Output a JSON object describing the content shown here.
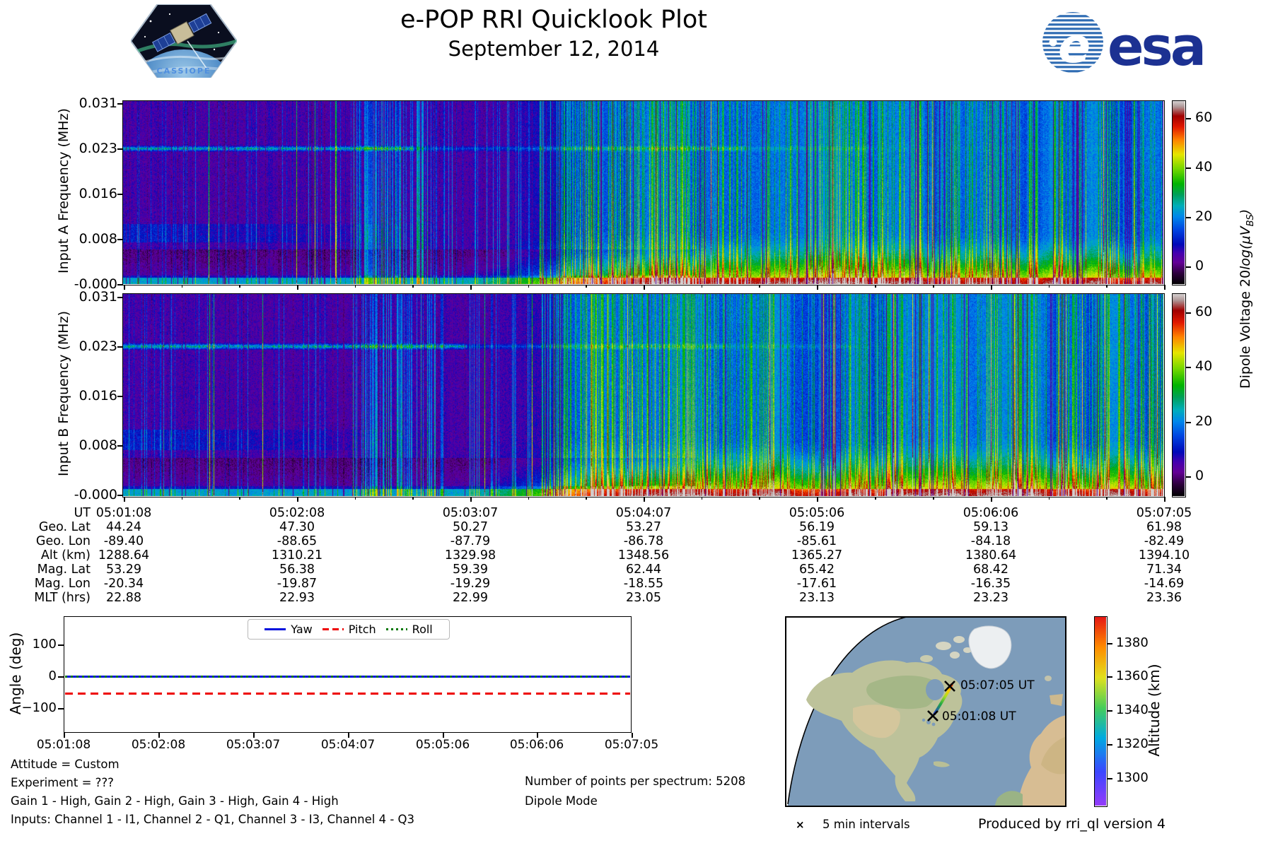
{
  "header": {
    "title": "e-POP RRI Quicklook Plot",
    "date": "September 12, 2014"
  },
  "logos": {
    "cassiope": "CASSIOPE",
    "esa": "esa",
    "esa_e": "e"
  },
  "colorbar": {
    "label_prefix": "Dipole Voltage 20",
    "label_log": "log(μV",
    "label_sub": "BS",
    "label_close": ")",
    "ticks": [
      "60",
      "40",
      "20",
      "0"
    ]
  },
  "footer": {
    "attitude": "Attitude = Custom",
    "experiment": "Experiment = ???",
    "gains": "Gain 1 - High, Gain 2 - High, Gain 3 - High, Gain 4 - High",
    "inputs": "Inputs: Channel 1 - I1, Channel 2 - Q1, Channel 3 - I3, Channel 4 - Q3",
    "points": "Number of points per spectrum: 5208",
    "mode": "Dipole Mode"
  },
  "map": {
    "start_label": "05:01:08 UT",
    "end_label": "05:07:05 UT",
    "legend_marker": "×",
    "legend_text": "5 min intervals",
    "produced_by": "Produced by rri_ql version 4",
    "colorbar_label": "Altitude (km)",
    "colorbar_ticks": [
      "1380",
      "1360",
      "1340",
      "1320",
      "1300"
    ]
  },
  "chart_data": [
    {
      "type": "heatmap",
      "id": "spectrogram_input_a",
      "ylabel": "Input A Frequency (MHz)",
      "yticks": [
        "0.031",
        "0.023",
        "0.016",
        "0.008",
        "-0.000"
      ],
      "y_range_mhz": [
        0.0,
        0.031
      ],
      "xticks_ut": [
        "05:01:08",
        "05:02:08",
        "05:03:07",
        "05:04:07",
        "05:05:06",
        "05:06:06",
        "05:07:05"
      ],
      "value_label": "Dipole Voltage 20log(μV_BS)",
      "value_ticks": [
        0,
        20,
        40,
        60
      ],
      "value_range": [
        -7.5,
        66.5
      ],
      "colormap": "nipy_spectral",
      "features": [
        "persistent narrowband emission line at 0.023 MHz, fading after ~05:03",
        "faint band near 0.008-0.010 MHz before 05:03",
        "dense vertical interference streaks throughout",
        "background rises from near-black to blue after ~05:03:30",
        "bright green broadband enhancement at lowest frequencies on right half"
      ]
    },
    {
      "type": "heatmap",
      "id": "spectrogram_input_b",
      "ylabel": "Input B Frequency (MHz)",
      "yticks": [
        "0.031",
        "0.023",
        "0.016",
        "0.008",
        "-0.000"
      ],
      "y_range_mhz": [
        0.0,
        0.031
      ],
      "xticks_ut": [
        "05:01:08",
        "05:02:08",
        "05:03:07",
        "05:04:07",
        "05:05:06",
        "05:06:06",
        "05:07:05"
      ],
      "value_label": "Dipole Voltage 20log(μV_BS)",
      "value_ticks": [
        0,
        20,
        40,
        60
      ],
      "value_range": [
        -7.5,
        66.5
      ],
      "colormap": "nipy_spectral",
      "features": [
        "same morphology as Input A: 0.023 MHz line, interference streaks, low-frequency green band after ~05:03"
      ]
    },
    {
      "type": "table",
      "id": "ephemeris",
      "rows": [
        {
          "label": "UT",
          "values": [
            "05:01:08",
            "05:02:08",
            "05:03:07",
            "05:04:07",
            "05:05:06",
            "05:06:06",
            "05:07:05"
          ]
        },
        {
          "label": "Geo. Lat",
          "values": [
            "44.24",
            "47.30",
            "50.27",
            "53.27",
            "56.19",
            "59.13",
            "61.98"
          ]
        },
        {
          "label": "Geo. Lon",
          "values": [
            "-89.40",
            "-88.65",
            "-87.79",
            "-86.78",
            "-85.61",
            "-84.18",
            "-82.49"
          ]
        },
        {
          "label": "Alt (km)",
          "values": [
            "1288.64",
            "1310.21",
            "1329.98",
            "1348.56",
            "1365.27",
            "1380.64",
            "1394.10"
          ]
        },
        {
          "label": "Mag. Lat",
          "values": [
            "53.29",
            "56.38",
            "59.39",
            "62.44",
            "65.42",
            "68.42",
            "71.34"
          ]
        },
        {
          "label": "Mag. Lon",
          "values": [
            "-20.34",
            "-19.87",
            "-19.29",
            "-18.55",
            "-17.61",
            "-16.35",
            "-14.69"
          ]
        },
        {
          "label": "MLT (hrs)",
          "values": [
            "22.88",
            "22.93",
            "22.99",
            "23.05",
            "23.13",
            "23.23",
            "23.36"
          ]
        }
      ]
    },
    {
      "type": "line",
      "id": "attitude_angles",
      "ylabel": "Angle (deg)",
      "yticks": [
        "100",
        "0",
        "−100"
      ],
      "ylim": [
        -185,
        185
      ],
      "xticks": [
        "05:01:08",
        "05:02:08",
        "05:03:07",
        "05:04:07",
        "05:05:06",
        "05:06:06",
        "05:07:05"
      ],
      "legend_position": "upper center",
      "series": [
        {
          "name": "Yaw",
          "color": "#0011dd",
          "style": "solid",
          "values": [
            0,
            0,
            0,
            0,
            0,
            0,
            0
          ]
        },
        {
          "name": "Pitch",
          "color": "#ee0000",
          "style": "dashed",
          "values": [
            -55,
            -55,
            -55,
            -55,
            -55,
            -55,
            -55
          ]
        },
        {
          "name": "Roll",
          "color": "#007700",
          "style": "dotted",
          "values": [
            0,
            0,
            0,
            0,
            0,
            0,
            0
          ]
        }
      ]
    },
    {
      "type": "map-track",
      "id": "ground_track",
      "region": "North America / North Atlantic orthographic view",
      "track": {
        "start_ut": "05:01:08",
        "end_ut": "05:07:05",
        "start_geo_lat_lon": [
          44.24,
          -89.4
        ],
        "end_geo_lat_lon": [
          61.98,
          -82.49
        ],
        "altitude_km_range": [
          1288.64,
          1394.1
        ]
      },
      "colorbar": {
        "label": "Altitude (km)",
        "ticks": [
          1380,
          1360,
          1340,
          1320,
          1300
        ],
        "range": [
          1285,
          1396
        ]
      },
      "marker_legend": "5 min intervals"
    }
  ]
}
